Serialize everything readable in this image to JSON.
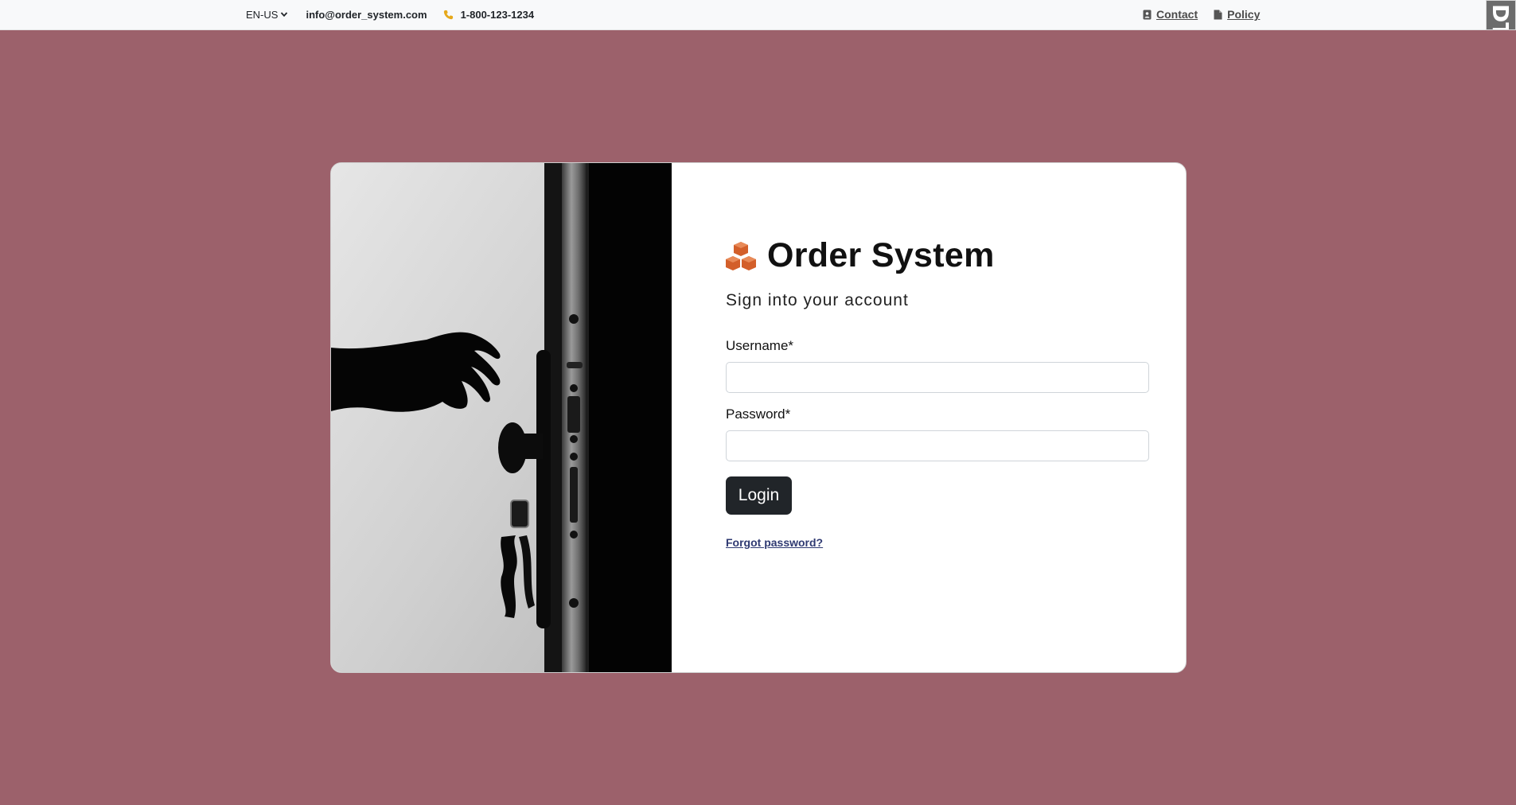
{
  "topbar": {
    "language": "EN-US",
    "email": "info@order_system.com",
    "phone": "1-800-123-1234",
    "links": {
      "contact": "Contact",
      "policy": "Policy"
    },
    "corner_tab_text": "DT"
  },
  "login": {
    "brand_name": "Order System",
    "subtitle": "Sign into your account",
    "username_label": "Username*",
    "username_value": "",
    "password_label": "Password*",
    "password_value": "",
    "login_button": "Login",
    "forgot_password": "Forgot password?"
  },
  "icons": {
    "language_dropdown": "chevron-down-icon",
    "phone": "phone-icon",
    "contact": "address-book-icon",
    "policy": "document-icon",
    "brand": "boxes-icon"
  },
  "colors": {
    "page_background": "#9c616b",
    "topbar_background": "#f8f9fa",
    "brand_icon": "#d35f2a",
    "phone_icon": "#e6a81a",
    "login_button": "#212529",
    "forgot_link": "#2f3a72"
  }
}
